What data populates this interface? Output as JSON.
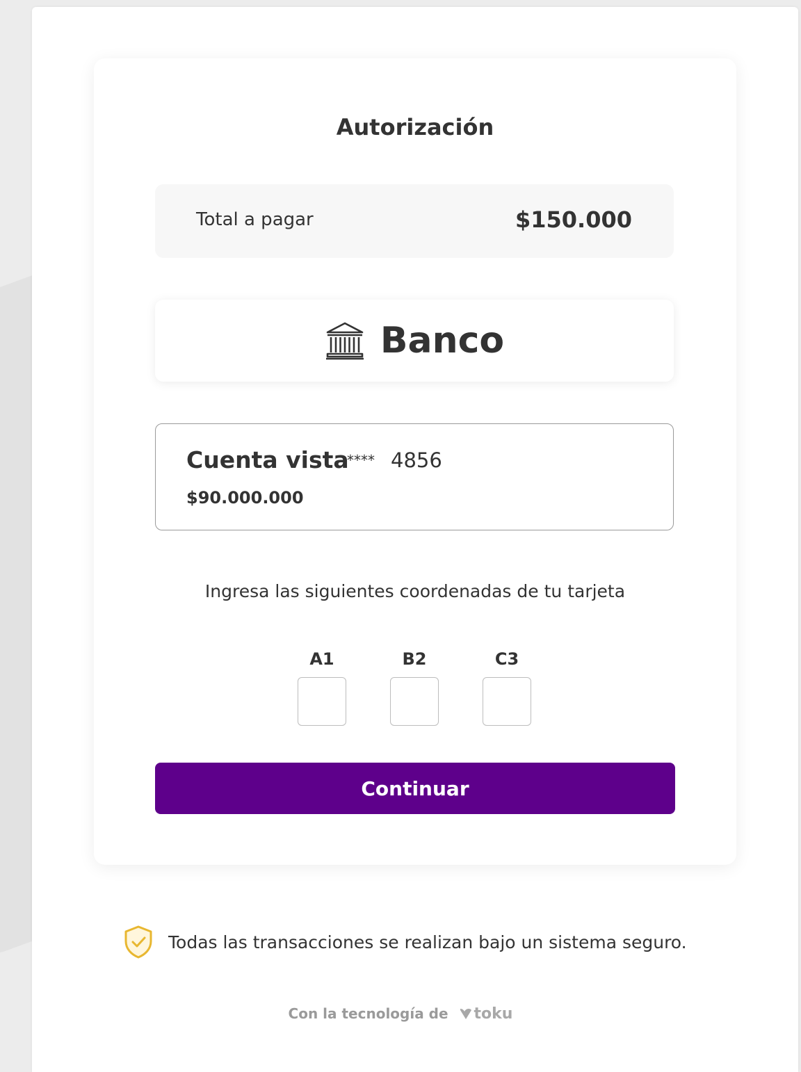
{
  "card": {
    "title": "Autorización",
    "total": {
      "label": "Total a pagar",
      "amount": "$150.000"
    },
    "bank": {
      "icon": "bank-icon",
      "name": "Banco"
    },
    "account": {
      "type": "Cuenta vista",
      "mask": "****",
      "last4": "4856",
      "balance": "$90.000.000"
    },
    "instruction": "Ingresa las siguientes coordenadas de tu tarjeta",
    "coordinates": [
      {
        "label": "A1",
        "value": ""
      },
      {
        "label": "B2",
        "value": ""
      },
      {
        "label": "C3",
        "value": ""
      }
    ],
    "continue_label": "Continuar"
  },
  "footer": {
    "secure_icon": "shield-check-icon",
    "secure_text": "Todas las transacciones se realizan bajo un sistema seguro.",
    "powered_prefix": "Con la tecnología de",
    "powered_brand": "toku"
  },
  "colors": {
    "primary": "#5e008b",
    "shield": "#e8b730",
    "text": "#333333",
    "muted": "#9a9a9a"
  }
}
